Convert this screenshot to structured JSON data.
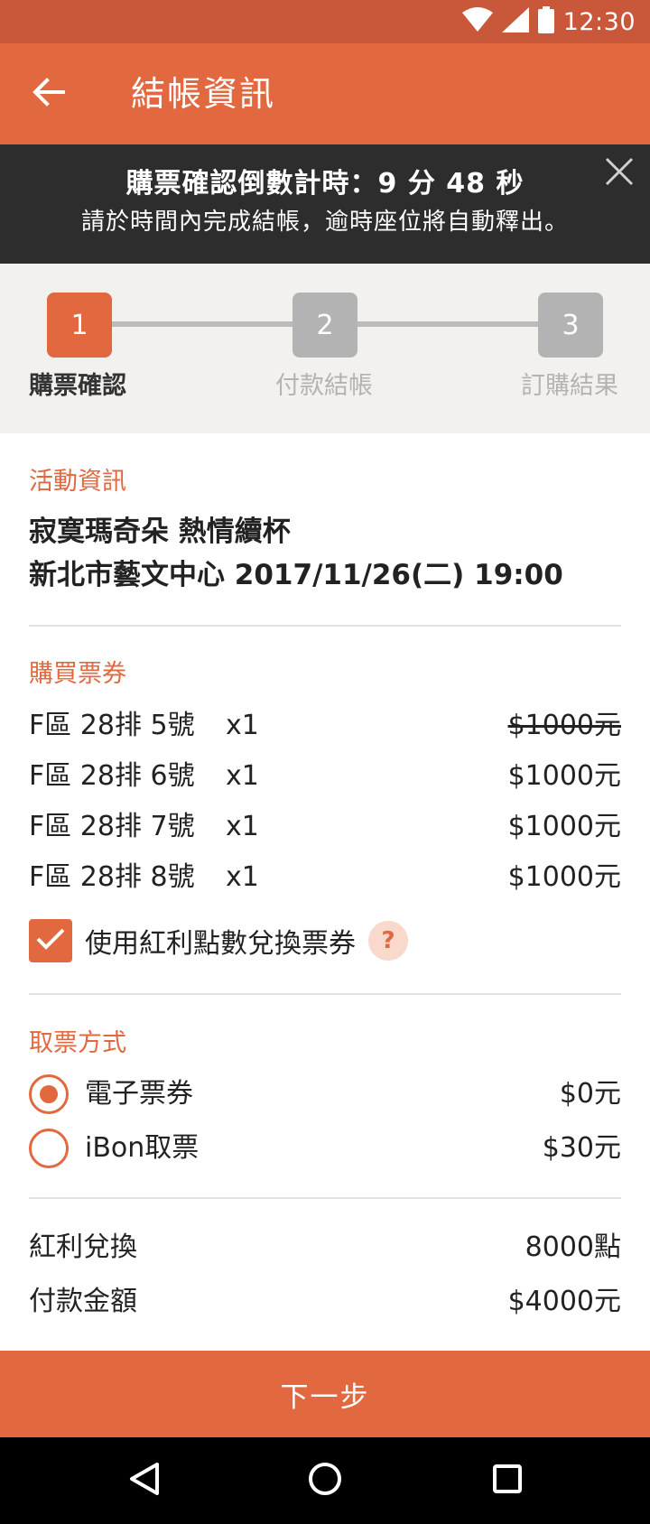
{
  "status_bar": {
    "time": "12:30"
  },
  "app_bar": {
    "title": "結帳資訊"
  },
  "timer": {
    "line1": "購票確認倒數計時：9 分 48 秒",
    "line2": "請於時間內完成結帳，逾時座位將自動釋出。"
  },
  "stepper": {
    "steps": [
      {
        "number": "1",
        "label": "購票確認"
      },
      {
        "number": "2",
        "label": "付款結帳"
      },
      {
        "number": "3",
        "label": "訂購結果"
      }
    ]
  },
  "event": {
    "section_title": "活動資訊",
    "name": "寂寞瑪奇朵  熱情續杯",
    "venue_datetime": "新北市藝文中心  2017/11/26(二) 19:00"
  },
  "tickets": {
    "section_title": "購買票券",
    "rows": [
      {
        "seat": "F區 28排 5號",
        "qty": "x1",
        "price": "$1000元"
      },
      {
        "seat": "F區 28排 6號",
        "qty": "x1",
        "price": "$1000元"
      },
      {
        "seat": "F區 28排 7號",
        "qty": "x1",
        "price": "$1000元"
      },
      {
        "seat": "F區 28排 8號",
        "qty": "x1",
        "price": "$1000元"
      }
    ],
    "bonus_checkbox_label": "使用紅利點數兌換票券",
    "bonus_checked": true,
    "help_icon": "?"
  },
  "pickup": {
    "section_title": "取票方式",
    "options": [
      {
        "label": "電子票券",
        "price": "$0元",
        "selected": true
      },
      {
        "label": "iBon取票",
        "price": "$30元",
        "selected": false
      }
    ]
  },
  "summary": {
    "bonus_label": "紅利兌換",
    "bonus_value": "8000點",
    "payment_label": "付款金額",
    "payment_value": "$4000元"
  },
  "next_button": {
    "label": "下一步"
  },
  "colors": {
    "accent": "#e2683f",
    "status_bar": "#c9573a",
    "banner": "#2d2d2d",
    "stepper_bg": "#f2f1ee",
    "inactive_step": "#b3b3b3"
  }
}
